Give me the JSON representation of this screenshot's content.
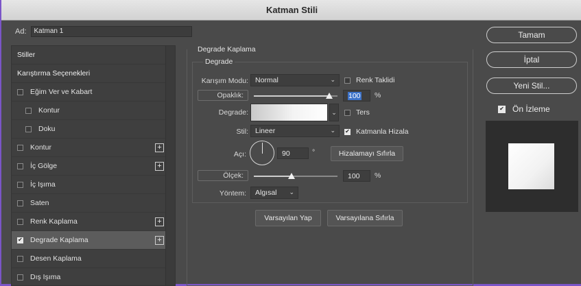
{
  "window": {
    "title": "Katman Stili"
  },
  "name_field": {
    "label": "Ad:",
    "value": "Katman 1"
  },
  "styles_list": {
    "items": [
      {
        "label": "Stiller",
        "type": "head",
        "checkbox": false,
        "checked": false,
        "plus": false
      },
      {
        "label": "Karıştırma Seçenekleri",
        "type": "head",
        "checkbox": false,
        "checked": false,
        "plus": false
      },
      {
        "label": "Eğim Ver ve Kabart",
        "type": "item",
        "checkbox": true,
        "checked": false,
        "plus": false
      },
      {
        "label": "Kontur",
        "type": "sub",
        "checkbox": true,
        "checked": false,
        "plus": false
      },
      {
        "label": "Doku",
        "type": "sub",
        "checkbox": true,
        "checked": false,
        "plus": false
      },
      {
        "label": "Kontur",
        "type": "item",
        "checkbox": true,
        "checked": false,
        "plus": true
      },
      {
        "label": "İç Gölge",
        "type": "item",
        "checkbox": true,
        "checked": false,
        "plus": true
      },
      {
        "label": "İç Işıma",
        "type": "item",
        "checkbox": true,
        "checked": false,
        "plus": false
      },
      {
        "label": "Saten",
        "type": "item",
        "checkbox": true,
        "checked": false,
        "plus": false
      },
      {
        "label": "Renk Kaplama",
        "type": "item",
        "checkbox": true,
        "checked": false,
        "plus": true
      },
      {
        "label": "Degrade Kaplama",
        "type": "item",
        "checkbox": true,
        "checked": true,
        "plus": true,
        "selected": true
      },
      {
        "label": "Desen Kaplama",
        "type": "item",
        "checkbox": true,
        "checked": false,
        "plus": false
      },
      {
        "label": "Dış Işıma",
        "type": "item",
        "checkbox": true,
        "checked": false,
        "plus": false
      }
    ]
  },
  "panel": {
    "outer_title": "Degrade Kaplama",
    "inner_title": "Degrade",
    "blend_mode": {
      "label": "Karışım Modu:",
      "value": "Normal"
    },
    "dither": {
      "label": "Renk Taklidi",
      "checked": false
    },
    "opacity": {
      "label": "Opaklık:",
      "value": "100",
      "unit": "%",
      "level": 1.0
    },
    "gradient": {
      "label": "Degrade:"
    },
    "reverse": {
      "label": "Ters",
      "checked": false
    },
    "style": {
      "label": "Stil:",
      "value": "Lineer"
    },
    "align": {
      "label": "Katmanla Hizala",
      "checked": true
    },
    "angle": {
      "label": "Açı:",
      "value": "90",
      "unit": "°"
    },
    "reset_align": {
      "label": "Hizalamayı Sıfırla"
    },
    "scale": {
      "label": "Ölçek:",
      "value": "100",
      "unit": "%",
      "level": 0.5
    },
    "method": {
      "label": "Yöntem:",
      "value": "Algısal"
    },
    "make_default": {
      "label": "Varsayılan Yap"
    },
    "reset_default": {
      "label": "Varsayılana Sıfırla"
    }
  },
  "actions": {
    "ok": "Tamam",
    "cancel": "İptal",
    "new_style": "Yeni Stil...",
    "preview": {
      "label": "Ön İzleme",
      "checked": true
    }
  }
}
